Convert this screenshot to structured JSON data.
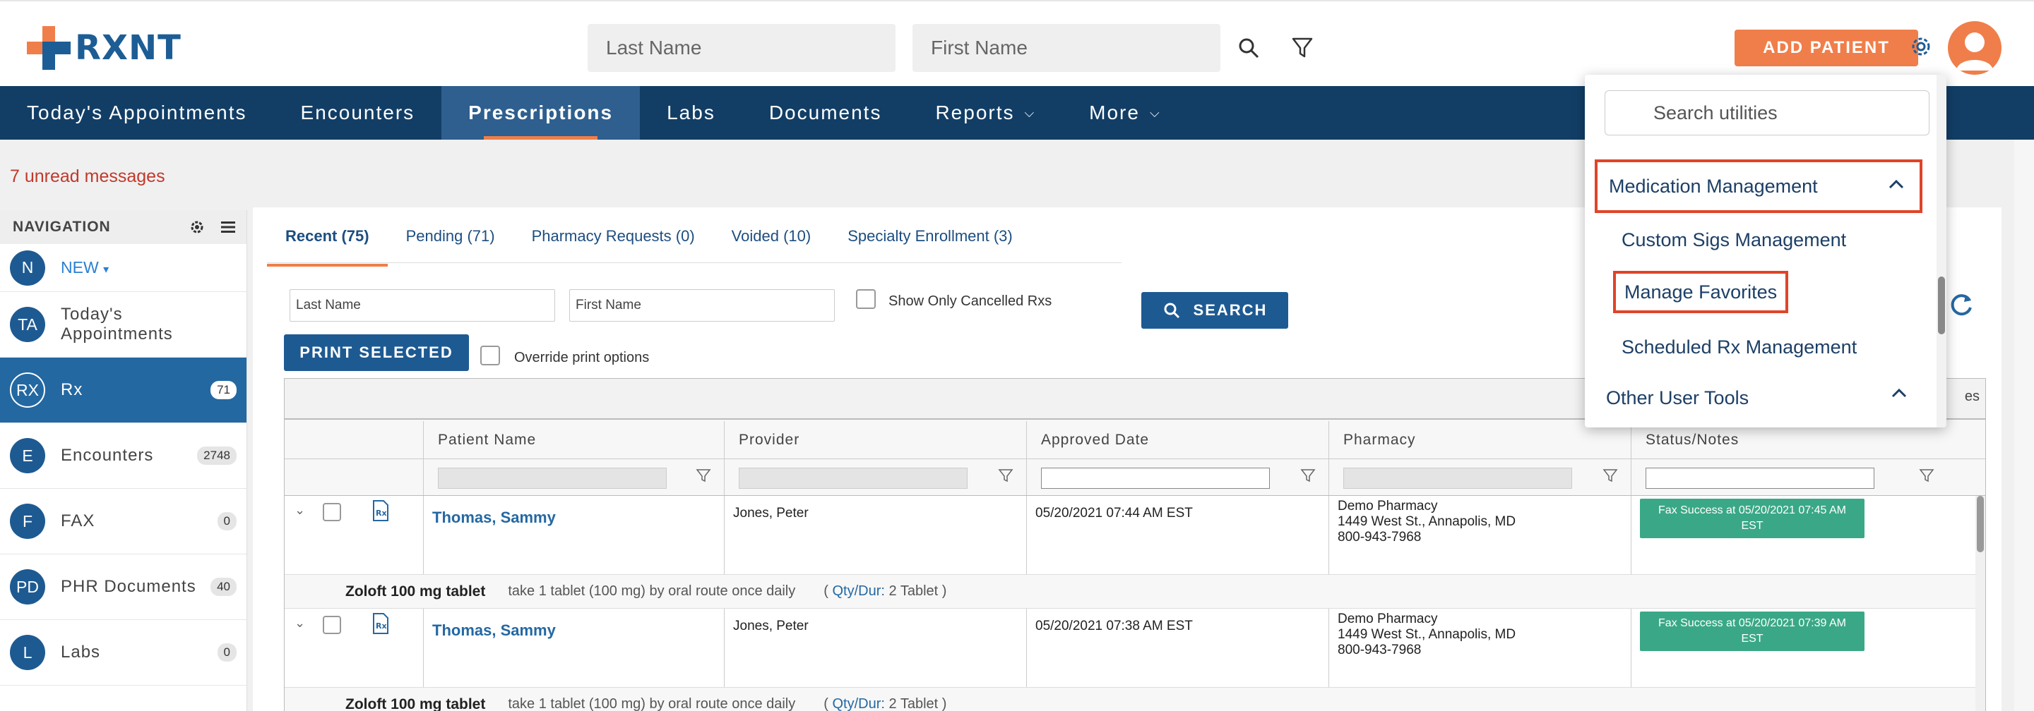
{
  "brand": {
    "name": "RXNT"
  },
  "header": {
    "last_name_placeholder": "Last Name",
    "first_name_placeholder": "First Name",
    "add_patient_label": "ADD PATIENT",
    "accent_color": "#f07e4a",
    "primary_color": "#123e66"
  },
  "mainnav": {
    "items": [
      {
        "label": "Today's Appointments"
      },
      {
        "label": "Encounters"
      },
      {
        "label": "Prescriptions",
        "active": true
      },
      {
        "label": "Labs"
      },
      {
        "label": "Documents"
      },
      {
        "label": "Reports"
      },
      {
        "label": "More"
      }
    ]
  },
  "messages": {
    "unread": "7 unread messages"
  },
  "leftnav": {
    "title": "NAVIGATION",
    "new_badge": "N",
    "new_label": "NEW",
    "items": [
      {
        "badge": "TA",
        "label": "Today's Appointments",
        "count": ""
      },
      {
        "badge": "RX",
        "label": "Rx",
        "count": "71",
        "active": true
      },
      {
        "badge": "E",
        "label": "Encounters",
        "count": "2748"
      },
      {
        "badge": "F",
        "label": "FAX",
        "count": "0"
      },
      {
        "badge": "PD",
        "label": "PHR Documents",
        "count": "40"
      },
      {
        "badge": "L",
        "label": "Labs",
        "count": "0"
      }
    ]
  },
  "rx_tabs": [
    {
      "label": "Recent (75)",
      "active": true
    },
    {
      "label": "Pending (71)"
    },
    {
      "label": "Pharmacy Requests (0)"
    },
    {
      "label": "Voided (10)"
    },
    {
      "label": "Specialty Enrollment (3)"
    }
  ],
  "filters": {
    "last_name_placeholder": "Last Name",
    "first_name_placeholder": "First Name",
    "show_cancelled_label": "Show Only Cancelled Rxs",
    "search_label": "SEARCH",
    "print_selected_label": "PRINT SELECTED",
    "override_print_label": "Override print options"
  },
  "grid": {
    "top_suffix": "es",
    "columns": [
      "Patient Name",
      "Provider",
      "Approved Date",
      "Pharmacy",
      "Status/Notes"
    ],
    "rows": [
      {
        "patient": "Thomas, Sammy",
        "provider": "Jones, Peter",
        "approved": "05/20/2021 07:44 AM EST",
        "pharmacy_name": "Demo Pharmacy",
        "pharmacy_addr": "1449 West St., Annapolis, MD",
        "pharmacy_phone": "800-943-7968",
        "status": "Fax Success at 05/20/2021 07:45 AM EST",
        "med": "Zoloft 100 mg tablet",
        "sig": "take 1 tablet (100 mg) by oral route once daily",
        "qty_open": "(",
        "qty_label": "Qty/Dur:",
        "qty": "2 Tablet )"
      },
      {
        "patient": "Thomas, Sammy",
        "provider": "Jones, Peter",
        "approved": "05/20/2021 07:38 AM EST",
        "pharmacy_name": "Demo Pharmacy",
        "pharmacy_addr": "1449 West St., Annapolis, MD",
        "pharmacy_phone": "800-943-7968",
        "status": "Fax Success at 05/20/2021 07:39 AM EST",
        "med": "Zoloft 100 mg tablet",
        "sig": "take 1 tablet (100 mg) by oral route once daily",
        "qty_open": "(",
        "qty_label": "Qty/Dur:",
        "qty": "2 Tablet )"
      }
    ]
  },
  "utilities_dropdown": {
    "search_placeholder": "Search utilities",
    "sections": [
      {
        "label": "Medication Management",
        "expanded": true,
        "highlighted": true,
        "items": [
          {
            "label": "Custom Sigs Management"
          },
          {
            "label": "Manage Favorites",
            "highlighted": true
          },
          {
            "label": "Scheduled Rx Management"
          }
        ]
      },
      {
        "label": "Other User Tools",
        "expanded": true
      }
    ],
    "highlight_color": "#e04428"
  }
}
